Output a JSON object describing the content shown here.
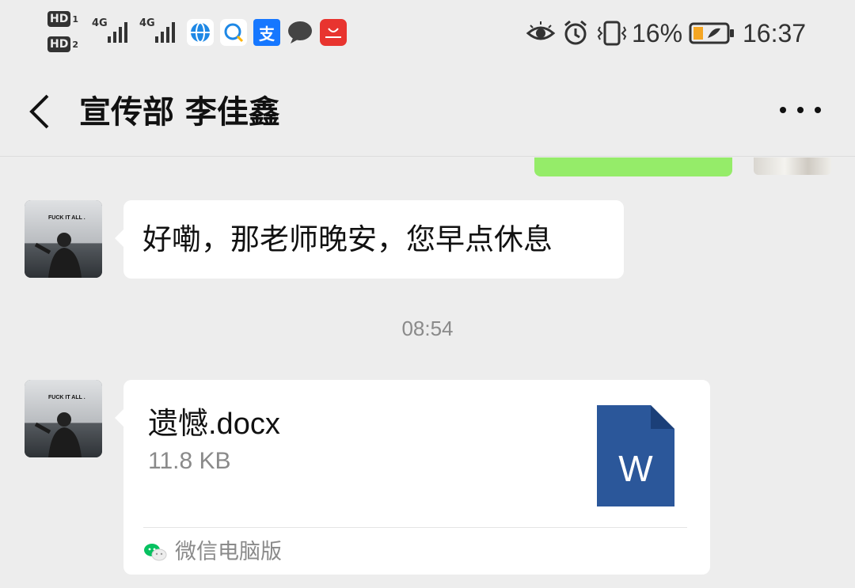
{
  "status_bar": {
    "sim1": {
      "label": "HD",
      "index": "1",
      "network": "4G"
    },
    "sim2": {
      "label": "HD",
      "index": "2",
      "network": "4G"
    },
    "apps": [
      "browser-icon",
      "qq-browser-icon",
      "alipay-icon",
      "message-icon",
      "huawei-appgallery-icon"
    ],
    "battery_percent": "16%",
    "time": "16:37"
  },
  "header": {
    "title": "宣传部 李佳鑫"
  },
  "messages": [
    {
      "type": "text",
      "from": "contact",
      "text": "好嘞，那老师晚安，您早点休息"
    }
  ],
  "timestamp": "08:54",
  "file_message": {
    "from": "contact",
    "file_name": "遗憾.docx",
    "file_size": "11.8 KB",
    "file_icon_letter": "W",
    "source_label": "微信电脑版"
  },
  "avatar_text": "FUCK IT ALL .",
  "colors": {
    "background": "#ededed",
    "sent_bubble": "#95ec69",
    "word_blue": "#2b579a",
    "muted_text": "#8a8a8a",
    "wechat_green": "#07c160"
  }
}
